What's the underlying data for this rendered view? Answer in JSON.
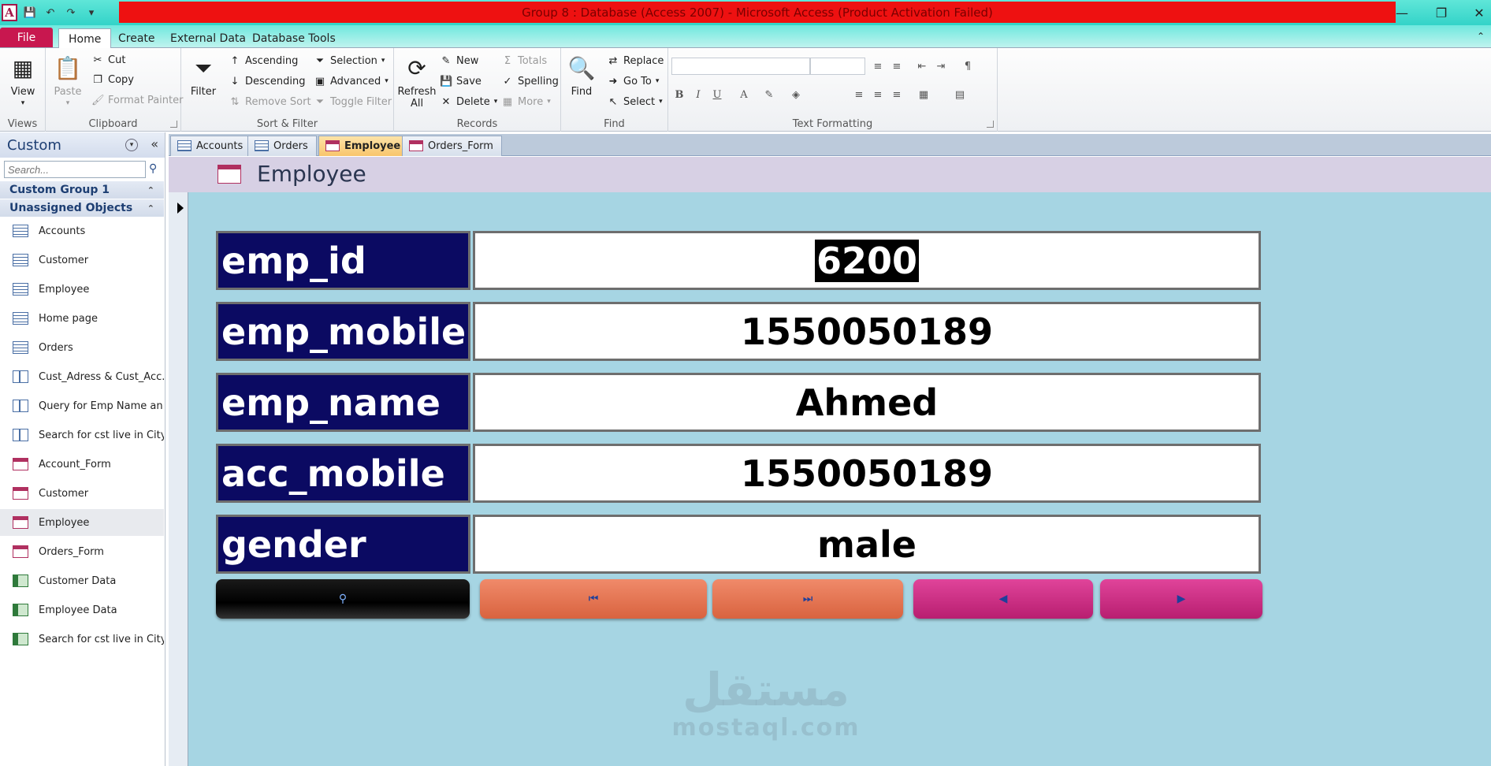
{
  "window": {
    "title": "Group 8 : Database (Access 2007) - Microsoft Access (Product Activation Failed)",
    "colors": {
      "title_bar": "#ee1111",
      "file_tab": "#c8174f",
      "form_background": "#a6d5e3",
      "label_background": "#0b0a62"
    }
  },
  "qat": {
    "logo_letter": "A",
    "icons": [
      "save-icon",
      "undo-icon",
      "redo-icon",
      "customize-icon"
    ]
  },
  "ribbon_tabs": [
    "File",
    "Home",
    "Create",
    "External Data",
    "Database Tools"
  ],
  "active_ribbon_tab": "Home",
  "ribbon": {
    "views": {
      "view_label": "View",
      "group_label": "Views"
    },
    "clipboard": {
      "paste_label": "Paste",
      "cut_label": "Cut",
      "copy_label": "Copy",
      "format_painter_label": "Format Painter",
      "group_label": "Clipboard"
    },
    "sort_filter": {
      "filter_label": "Filter",
      "ascending_label": "Ascending",
      "descending_label": "Descending",
      "remove_sort_label": "Remove Sort",
      "selection_label": "Selection",
      "advanced_label": "Advanced",
      "toggle_filter_label": "Toggle Filter",
      "group_label": "Sort & Filter"
    },
    "records": {
      "refresh_label": "Refresh",
      "refresh_sub_label": "All",
      "new_label": "New",
      "save_label": "Save",
      "delete_label": "Delete",
      "totals_label": "Totals",
      "spelling_label": "Spelling",
      "more_label": "More",
      "group_label": "Records"
    },
    "find": {
      "find_label": "Find",
      "replace_label": "Replace",
      "goto_label": "Go To",
      "select_label": "Select",
      "group_label": "Find"
    },
    "text_formatting": {
      "group_label": "Text Formatting",
      "bold": "B",
      "italic": "I",
      "underline": "U",
      "font_color": "A"
    }
  },
  "nav_pane": {
    "title": "Custom",
    "search_placeholder": "Search...",
    "groups": [
      {
        "label": "Custom Group 1"
      },
      {
        "label": "Unassigned Objects"
      }
    ],
    "items": [
      {
        "label": "Accounts",
        "type": "table"
      },
      {
        "label": "Customer",
        "type": "table"
      },
      {
        "label": "Employee",
        "type": "table"
      },
      {
        "label": "Home page",
        "type": "table"
      },
      {
        "label": "Orders",
        "type": "table"
      },
      {
        "label": "Cust_Adress & Cust_Acc...",
        "type": "query"
      },
      {
        "label": "Query for Emp Name an...",
        "type": "query"
      },
      {
        "label": "Search for cst live in City",
        "type": "query"
      },
      {
        "label": "Account_Form",
        "type": "form"
      },
      {
        "label": "Customer",
        "type": "form"
      },
      {
        "label": "Employee",
        "type": "form",
        "selected": true
      },
      {
        "label": "Orders_Form",
        "type": "form"
      },
      {
        "label": "Customer Data",
        "type": "report"
      },
      {
        "label": "Employee Data",
        "type": "report"
      },
      {
        "label": "Search for cst live in City...",
        "type": "report"
      }
    ]
  },
  "doc_tabs": [
    {
      "label": "Accounts",
      "type": "table"
    },
    {
      "label": "Orders",
      "type": "table"
    },
    {
      "label": "Employee",
      "type": "form",
      "active": true
    },
    {
      "label": "Orders_Form",
      "type": "form"
    }
  ],
  "form": {
    "title": "Employee",
    "fields": [
      {
        "label": "emp_id",
        "value": "6200",
        "selected": true
      },
      {
        "label": "emp_mobile",
        "value": "1550050189"
      },
      {
        "label": "emp_name",
        "value": "Ahmed"
      },
      {
        "label": "acc_mobile",
        "value": "1550050189"
      },
      {
        "label": "gender",
        "value": "male"
      }
    ],
    "buttons": [
      {
        "name": "search-record-button",
        "icon": "search-icon",
        "style": "black"
      },
      {
        "name": "first-record-button",
        "icon": "first-record-icon",
        "style": "orange"
      },
      {
        "name": "last-record-button",
        "icon": "last-record-icon",
        "style": "orange"
      },
      {
        "name": "previous-record-button",
        "icon": "previous-record-icon",
        "style": "pink"
      },
      {
        "name": "next-record-button",
        "icon": "next-record-icon",
        "style": "pink"
      }
    ]
  },
  "watermark": {
    "arabic": "مستقل",
    "latin": "mostaql.com"
  }
}
